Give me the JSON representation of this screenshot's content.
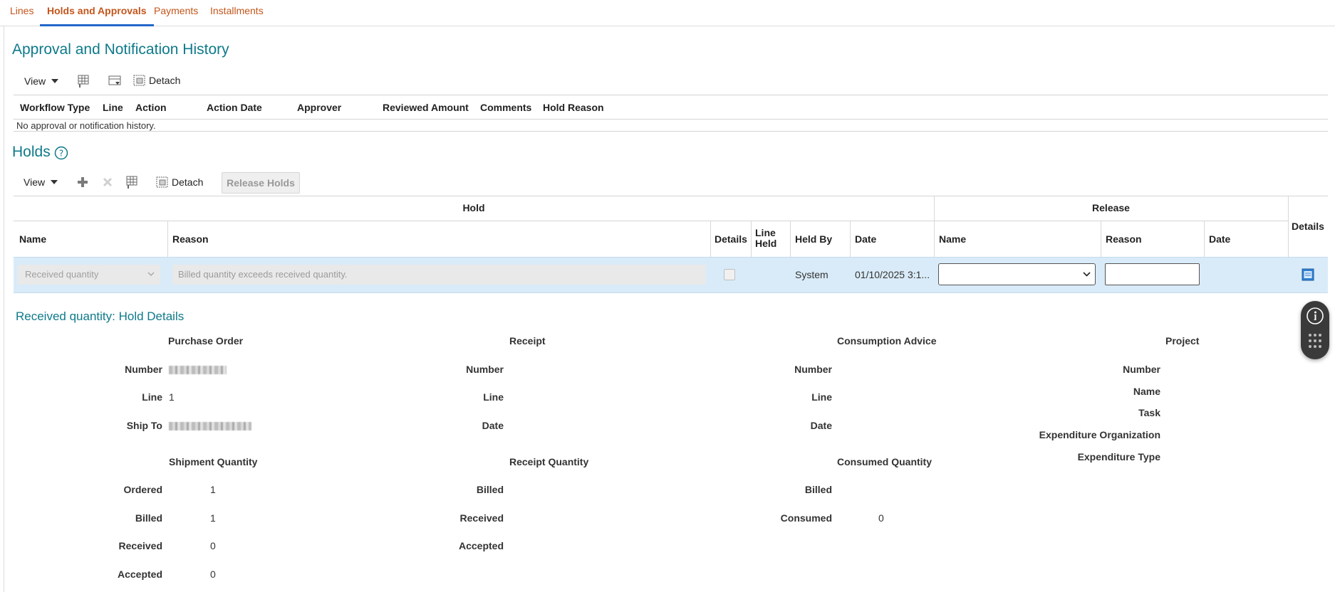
{
  "tabs": [
    {
      "label": "Lines"
    },
    {
      "label": "Holds and Approvals",
      "active": true
    },
    {
      "label": "Payments"
    },
    {
      "label": "Installments"
    }
  ],
  "approval": {
    "title": "Approval and Notification History",
    "view_label": "View",
    "detach_label": "Detach",
    "columns": [
      "Workflow Type",
      "Line",
      "Action",
      "Action Date",
      "Approver",
      "Reviewed Amount",
      "Comments",
      "Hold Reason"
    ],
    "empty_text": "No approval or notification history."
  },
  "holds": {
    "title": "Holds",
    "view_label": "View",
    "detach_label": "Detach",
    "release_button": "Release Holds",
    "group_hold": "Hold",
    "group_release": "Release",
    "columns": {
      "name": "Name",
      "reason": "Reason",
      "details": "Details",
      "line_held": "Line Held",
      "held_by": "Held By",
      "date": "Date",
      "release_name": "Name",
      "release_reason": "Reason",
      "release_date": "Date",
      "details_end": "Details"
    },
    "row": {
      "name": "Received quantity",
      "reason": "Billed quantity exceeds received quantity.",
      "held_by": "System",
      "date": "01/10/2025 3:1..."
    }
  },
  "details": {
    "title": "Received quantity: Hold Details",
    "purchase_order": {
      "heading": "Purchase Order",
      "number_label": "Number",
      "line_label": "Line",
      "line_value": "1",
      "ship_to_label": "Ship To"
    },
    "receipt": {
      "heading": "Receipt",
      "number_label": "Number",
      "line_label": "Line",
      "date_label": "Date"
    },
    "consumption": {
      "heading": "Consumption Advice",
      "number_label": "Number",
      "line_label": "Line",
      "date_label": "Date"
    },
    "project": {
      "heading": "Project",
      "number_label": "Number",
      "name_label": "Name",
      "task_label": "Task",
      "exp_org_label": "Expenditure Organization",
      "exp_type_label": "Expenditure Type"
    },
    "shipment_quantity": {
      "heading": "Shipment Quantity",
      "ordered_label": "Ordered",
      "ordered_value": "1",
      "billed_label": "Billed",
      "billed_value": "1",
      "received_label": "Received",
      "received_value": "0",
      "accepted_label": "Accepted",
      "accepted_value": "0"
    },
    "receipt_quantity": {
      "heading": "Receipt Quantity",
      "billed_label": "Billed",
      "received_label": "Received",
      "accepted_label": "Accepted"
    },
    "consumed_quantity": {
      "heading": "Consumed Quantity",
      "billed_label": "Billed",
      "consumed_label": "Consumed",
      "consumed_value": "0"
    }
  },
  "colors": {
    "accent": "#0e7a8a",
    "link": "#c4551b",
    "active_underline": "#2467c9",
    "row_selected": "#d9ebf8"
  }
}
